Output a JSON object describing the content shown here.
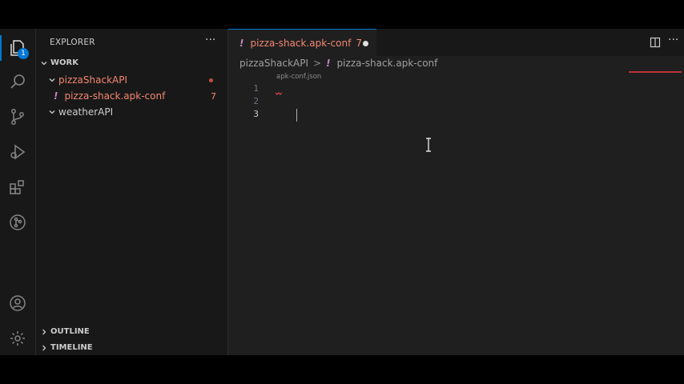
{
  "activity_bar": {
    "explorer_badge": "1",
    "icons": [
      "files-icon",
      "search-icon",
      "source-control-icon",
      "run-debug-icon",
      "extensions-icon",
      "git-graph-icon",
      "account-icon",
      "settings-gear-icon"
    ]
  },
  "sidebar": {
    "title": "EXPLORER",
    "more": "···",
    "workspace": "WORK",
    "tree": [
      {
        "label": "pizzaShackAPI"
      },
      {
        "prefix": "!",
        "label": "pizza-shack.apk-conf",
        "problems": "7"
      },
      {
        "label": "weatherAPI"
      }
    ],
    "outline": "OUTLINE",
    "timeline": "TIMELINE"
  },
  "editor": {
    "tab": {
      "prefix": "!",
      "label": "pizza-shack.apk-conf",
      "problems": "7"
    },
    "breadcrumb": {
      "folder": "pizzaShackAPI",
      "sep": ">",
      "prefix": "!",
      "file": "pizza-shack.apk-conf"
    },
    "schema_hint": "apk-conf.json",
    "line_numbers": [
      "1",
      "2",
      "3"
    ],
    "more": "···"
  },
  "colors": {
    "accent": "#0078d4",
    "error": "#f48771",
    "yaml_icon": "#c586c0"
  }
}
